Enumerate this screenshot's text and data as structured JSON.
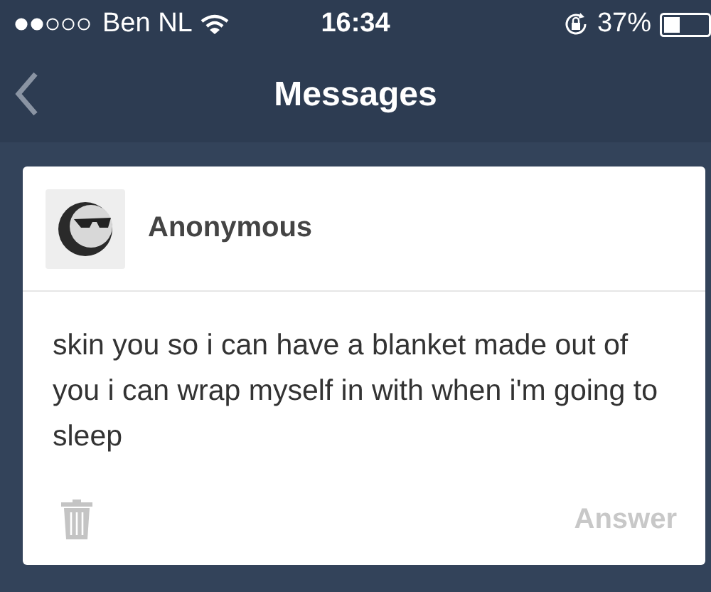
{
  "status_bar": {
    "carrier": "Ben NL",
    "time": "16:34",
    "battery": "37%"
  },
  "nav": {
    "title": "Messages"
  },
  "message": {
    "sender": "Anonymous",
    "text": "skin you so i can have a blanket made out of you i can wrap myself in with when i'm going to sleep",
    "action": "Answer"
  }
}
